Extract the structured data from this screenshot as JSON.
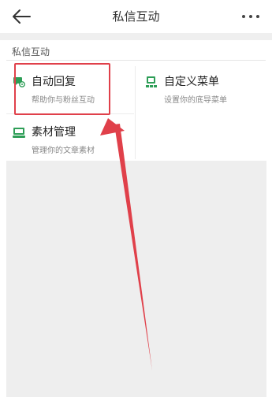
{
  "header": {
    "title": "私信互动"
  },
  "section": {
    "label": "私信互动"
  },
  "cards": [
    {
      "title": "自动回复",
      "desc": "帮助你与粉丝互动"
    },
    {
      "title": "自定义菜单",
      "desc": "设置你的底导菜单"
    },
    {
      "title": "素材管理",
      "desc": "管理你的文章素材"
    }
  ],
  "colors": {
    "accent_green": "#2e9e57",
    "highlight_red": "#e0404a"
  },
  "icons": {
    "back": "back-arrow-icon",
    "more": "more-dots-icon",
    "auto_reply": "auto-reply-icon",
    "custom_menu": "custom-menu-icon",
    "materials": "material-manage-icon"
  }
}
